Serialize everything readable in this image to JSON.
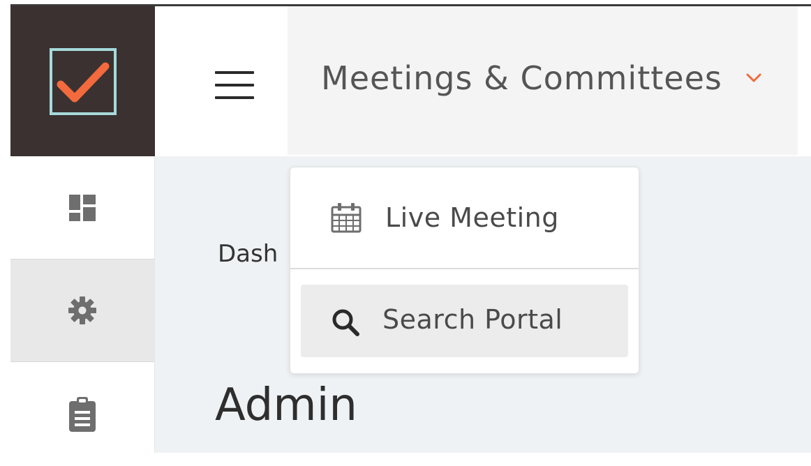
{
  "header": {
    "menu_title": "Meetings & Committees"
  },
  "dropdown": {
    "items": [
      {
        "label": "Live Meeting",
        "icon": "calendar-icon"
      },
      {
        "label": "Search Portal",
        "icon": "search-icon"
      }
    ]
  },
  "main": {
    "breadcrumb": "Dash",
    "page_title": "Admin"
  },
  "sidebar": {
    "items": [
      {
        "icon": "dashboard-icon"
      },
      {
        "icon": "gear-icon"
      },
      {
        "icon": "clipboard-icon"
      }
    ]
  },
  "colors": {
    "logo_bg": "#3b3131",
    "logo_border": "#a7dadb",
    "accent": "#f26a3d",
    "nav_bg": "#f4f4f4",
    "main_bg": "#eff2f4"
  }
}
